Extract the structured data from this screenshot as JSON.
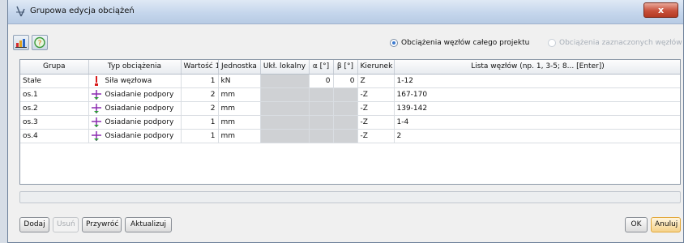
{
  "window": {
    "title": "Grupowa edycja obciążeń",
    "close_label": "x"
  },
  "toolbar": {
    "radio_project": "Obciążenia węzłów całego projektu",
    "radio_selected": "Obciążenia zaznaczonych węzłów",
    "radio_project_checked": true
  },
  "grid": {
    "headers": [
      "Grupa",
      "Typ obciążenia",
      "Wartość 1",
      "Jednostka",
      "Ukł. lokalny",
      "α [°]",
      "β [°]",
      "Kierunek",
      "Lista węzłów (np. 1, 3-5; 8... [Enter])"
    ],
    "rows": [
      {
        "group": "Stałe",
        "type": "Siła węzłowa",
        "icon": "force-icon",
        "value": "1",
        "unit": "kN",
        "local": "",
        "alpha": "0",
        "beta": "0",
        "dir": "Z",
        "nodes": "1-12"
      },
      {
        "group": "os.1",
        "type": "Osiadanie podpory",
        "icon": "support-settlement-icon",
        "value": "2",
        "unit": "mm",
        "local": "",
        "alpha": "",
        "beta": "",
        "dir": "-Z",
        "nodes": "167-170"
      },
      {
        "group": "os.2",
        "type": "Osiadanie podpory",
        "icon": "support-settlement-icon",
        "value": "2",
        "unit": "mm",
        "local": "",
        "alpha": "",
        "beta": "",
        "dir": "-Z",
        "nodes": "139-142"
      },
      {
        "group": "os.3",
        "type": "Osiadanie podpory",
        "icon": "support-settlement-icon",
        "value": "1",
        "unit": "mm",
        "local": "",
        "alpha": "",
        "beta": "",
        "dir": "-Z",
        "nodes": "1-4"
      },
      {
        "group": "os.4",
        "type": "Osiadanie podpory",
        "icon": "support-settlement-icon",
        "value": "1",
        "unit": "mm",
        "local": "",
        "alpha": "",
        "beta": "",
        "dir": "-Z",
        "nodes": "2"
      }
    ]
  },
  "buttons": {
    "add": "Dodaj",
    "remove": "Usuń",
    "restore": "Przywróć",
    "update": "Aktualizuj",
    "ok": "OK",
    "cancel": "Anuluj"
  },
  "colors": {
    "title_bar": "#c5d6ec",
    "close_button": "#c8503a",
    "disabled_cell": "#cfd1d4",
    "force_icon": "#d81b1b",
    "settlement_icon": "#8a2ab0"
  }
}
